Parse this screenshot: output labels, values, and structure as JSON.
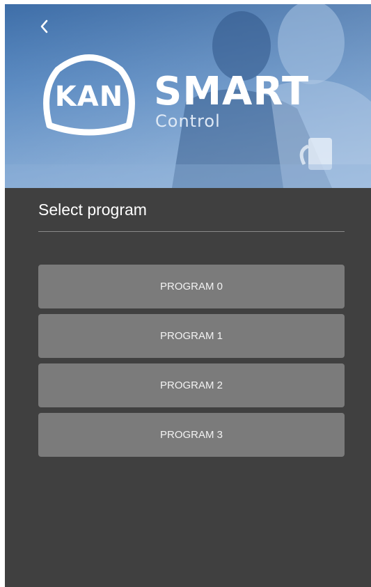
{
  "header": {
    "back_icon": "chevron-left-icon",
    "brand": {
      "logo_text": "KAN",
      "product_name": "SMART",
      "product_subtitle": "Control"
    }
  },
  "main": {
    "title": "Select program",
    "programs": [
      {
        "label": "PROGRAM 0"
      },
      {
        "label": "PROGRAM 1"
      },
      {
        "label": "PROGRAM 2"
      },
      {
        "label": "PROGRAM 3"
      }
    ]
  },
  "colors": {
    "background": "#404040",
    "button": "#7b7b7b",
    "hero_blue": "#4f82bd",
    "text": "#ffffff"
  }
}
